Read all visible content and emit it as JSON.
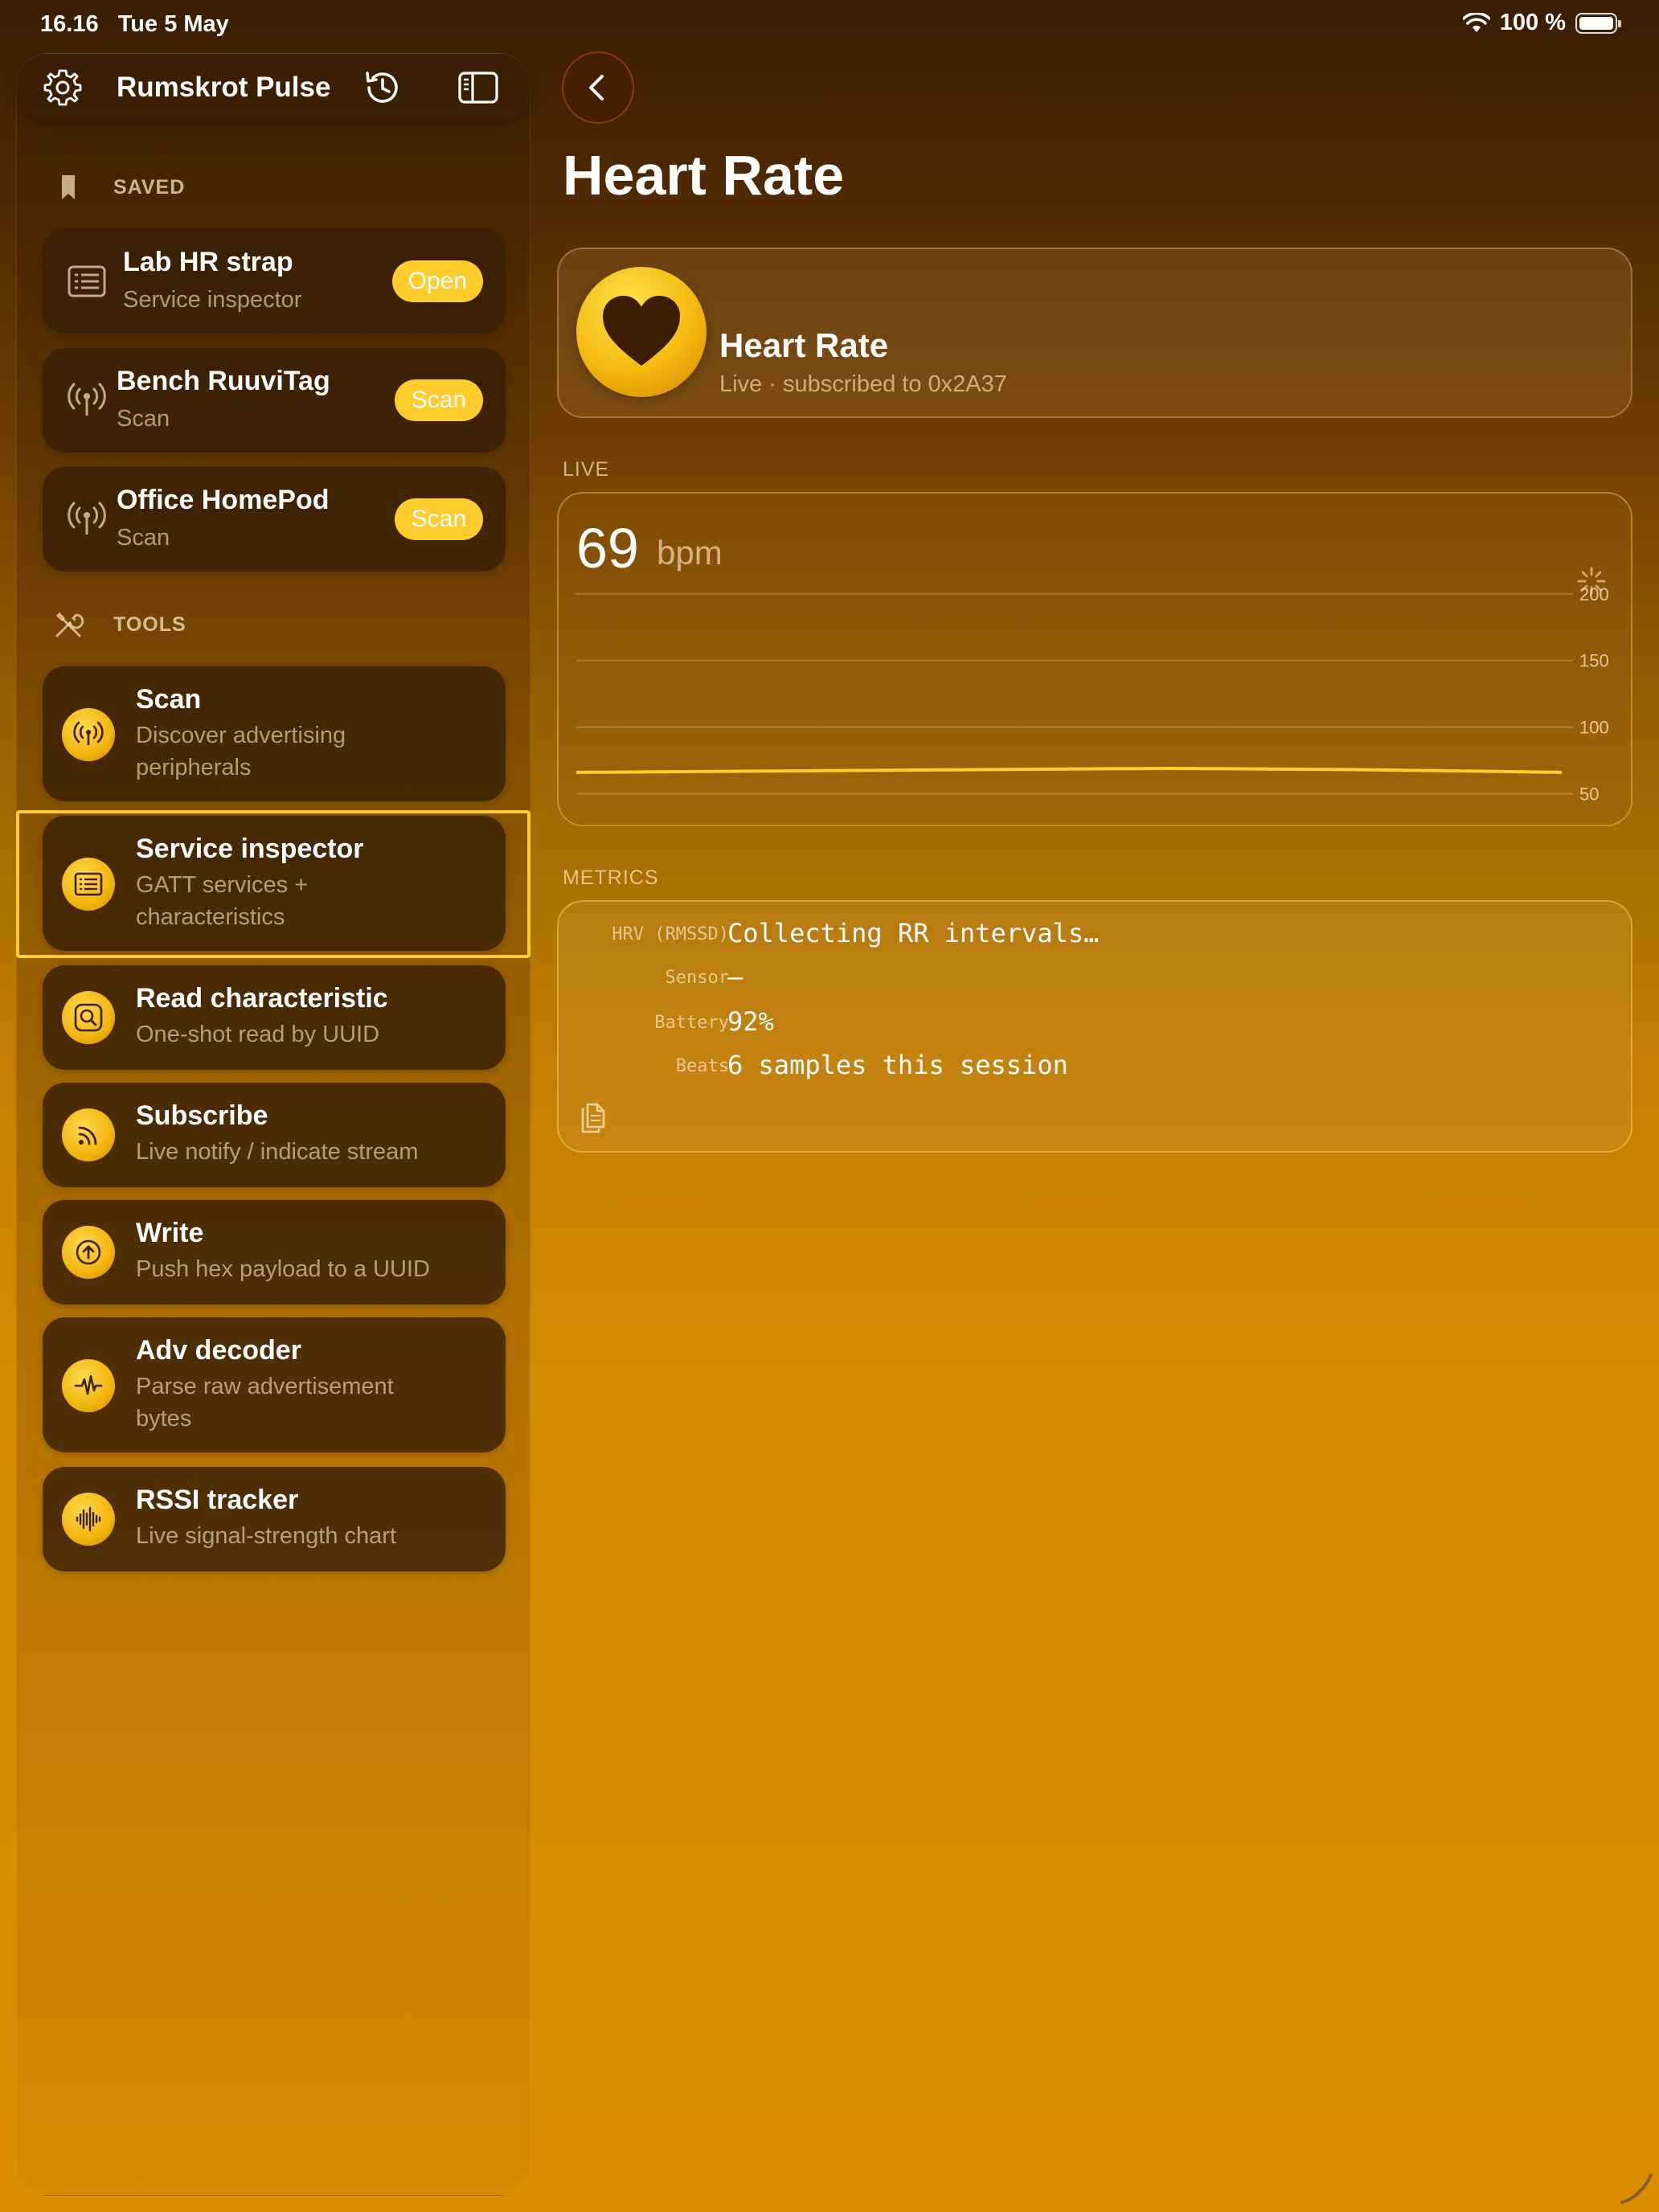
{
  "status": {
    "time": "16.16",
    "date": "Tue 5 May",
    "battery_pct": "100 %",
    "icons": [
      "wifi-icon",
      "battery-icon"
    ]
  },
  "sidebar": {
    "app_title": "Rumskrot Pulse",
    "header_icons": [
      "gear-icon",
      "history-icon",
      "sidebar-toggle-icon"
    ],
    "saved_label": "SAVED",
    "saved": [
      {
        "title": "Lab HR strap",
        "subtitle": "Service inspector",
        "action": "Open",
        "icon": "service-inspector-icon"
      },
      {
        "title": "Bench RuuviTag",
        "subtitle": "Scan",
        "action": "Scan",
        "icon": "antenna-icon"
      },
      {
        "title": "Office HomePod",
        "subtitle": "Scan",
        "action": "Scan",
        "icon": "antenna-icon"
      }
    ],
    "tools_label": "TOOLS",
    "tools": [
      {
        "title": "Scan",
        "sub1": "Discover advertising",
        "sub2": "peripherals",
        "icon": "antenna-icon"
      },
      {
        "title": "Service inspector",
        "sub1": "GATT services +",
        "sub2": "characteristics",
        "icon": "list-icon",
        "selected": true
      },
      {
        "title": "Read characteristic",
        "sub1": "One-shot read by UUID",
        "sub2": "",
        "icon": "magnifier-icon"
      },
      {
        "title": "Subscribe",
        "sub1": "Live notify / indicate stream",
        "sub2": "",
        "icon": "rss-icon"
      },
      {
        "title": "Write",
        "sub1": "Push hex payload to a UUID",
        "sub2": "",
        "icon": "upload-icon"
      },
      {
        "title": "Adv decoder",
        "sub1": "Parse raw advertisement",
        "sub2": "bytes",
        "icon": "waveform-icon"
      },
      {
        "title": "RSSI tracker",
        "sub1": "Live signal-strength chart",
        "sub2": "",
        "icon": "signal-wave-icon"
      }
    ],
    "accent": "#ffcc2e"
  },
  "detail": {
    "back_icon": "chevron-left-icon",
    "title": "Heart Rate",
    "hero": {
      "title": "Heart Rate",
      "subtitle": "Live · subscribed to 0x2A37",
      "icon": "heart-icon"
    },
    "live_label": "LIVE",
    "live": {
      "value": "69",
      "unit": "bpm",
      "spinner_icon": "activity-spinner-icon"
    },
    "metrics_label": "METRICS",
    "metrics": [
      {
        "key": "HRV (RMSSD)",
        "value": "Collecting RR intervals…"
      },
      {
        "key": "Sensor",
        "value": "—"
      },
      {
        "key": "Battery",
        "value": "92%"
      },
      {
        "key": "Beats",
        "value": "6 samples this session"
      }
    ],
    "copy_icon": "copy-icon"
  },
  "chart_data": {
    "type": "line",
    "title": "",
    "xlabel": "",
    "ylabel": "",
    "ylim": [
      40,
      215
    ],
    "yticks": [
      200,
      150,
      100,
      50
    ],
    "grid": true,
    "legend": "none",
    "color": "#ffcc2e",
    "x": [
      1,
      2,
      3,
      4,
      5,
      6
    ],
    "series": [
      {
        "values": [
          66,
          67,
          68,
          69,
          68,
          66
        ]
      }
    ]
  }
}
